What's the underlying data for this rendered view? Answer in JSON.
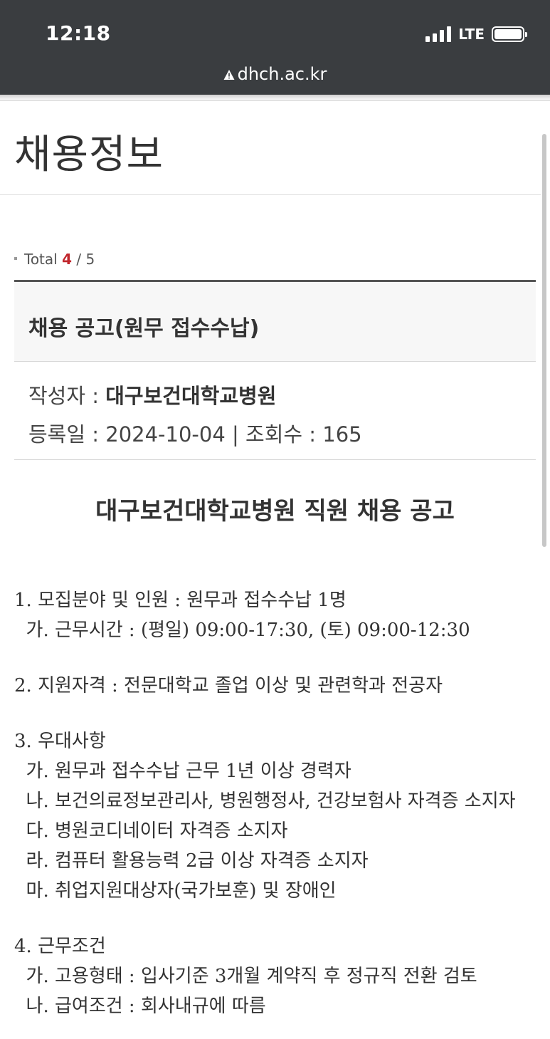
{
  "status_bar": {
    "time": "12:18",
    "network": "LTE",
    "signal_bars": 4,
    "battery_level_percent": 100
  },
  "browser": {
    "url": "dhch.ac.kr",
    "security_icon": "warning-triangle-icon"
  },
  "page": {
    "title": "채용정보"
  },
  "board": {
    "total_label": "Total",
    "current": "4",
    "separator": " / ",
    "total": "5"
  },
  "post": {
    "title": "채용 공고(원무 접수수납)",
    "writer_label": "작성자 : ",
    "writer": "대구보건대학교병원",
    "date_label": "등록일 : ",
    "date": "2024-10-04",
    "views_sep": " | ",
    "views_label": "조회수 : ",
    "views": "165"
  },
  "content": {
    "heading": "대구보건대학교병원 직원 채용 공고",
    "lines": [
      "1. 모집분야 및 인원 : 원무과 접수수납 1명",
      " 가. 근무시간 : (평일) 09:00-17:30, (토) 09:00-12:30",
      "",
      "2. 지원자격 : 전문대학교 졸업 이상 및 관련학과 전공자",
      "",
      "3. 우대사항",
      " 가. 원무과 접수수납 근무 1년 이상 경력자",
      " 나. 보건의료정보관리사, 병원행정사, 건강보험사 자격증 소지자",
      " 다. 병원코디네이터 자격증 소지자",
      " 라. 컴퓨터 활용능력 2급 이상 자격증 소지자",
      " 마. 취업지원대상자(국가보훈) 및 장애인",
      "",
      "4. 근무조건",
      " 가. 고용형태 : 입사기준 3개월 계약직 후 정규직 전환 검토",
      " 나. 급여조건 : 회사내규에 따름"
    ]
  }
}
